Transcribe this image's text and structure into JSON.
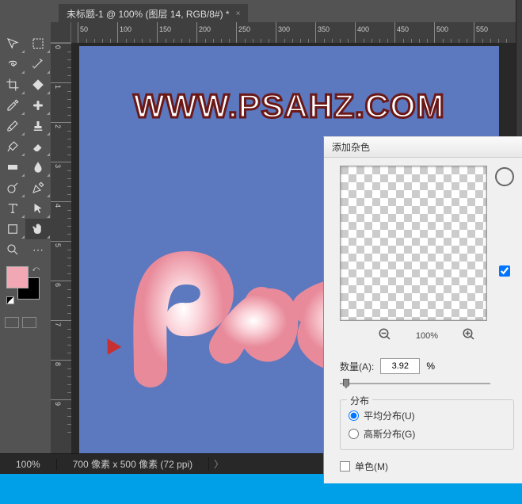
{
  "tab": {
    "title": "未标题-1 @ 100% (图层 14, RGB/8#) *"
  },
  "ruler_h": [
    50,
    100,
    150,
    200,
    250,
    300,
    350,
    400,
    450,
    500,
    550
  ],
  "ruler_v": [
    0,
    1,
    2,
    3,
    4,
    5,
    6,
    7,
    8,
    9
  ],
  "canvas": {
    "watermark": "WWW.PSAHZ.COM",
    "script": "Psa"
  },
  "status": {
    "zoom": "100%",
    "info": "700 像素 x 500 像素 (72 ppi)"
  },
  "dialog": {
    "title": "添加杂色",
    "zoom": "100%",
    "amount_label": "数量(A):",
    "amount_value": "3.92",
    "amount_unit": "%",
    "group_title": "分布",
    "radio1": "平均分布(U)",
    "radio2": "高斯分布(G)",
    "mono": "单色(M)"
  },
  "icons": {
    "move": "move",
    "marquee": "marquee",
    "lasso": "lasso",
    "wand": "wand",
    "crop": "crop",
    "slice": "slice",
    "eyedrop": "eyedrop",
    "heal": "heal",
    "brush": "brush",
    "stamp": "stamp",
    "history": "history",
    "eraser": "eraser",
    "gradient": "gradient",
    "blur": "blur",
    "dodge": "dodge",
    "pen": "pen",
    "type": "type",
    "path": "path",
    "shape": "shape",
    "hand": "hand",
    "zoom": "zoom",
    "edit": "edit"
  }
}
